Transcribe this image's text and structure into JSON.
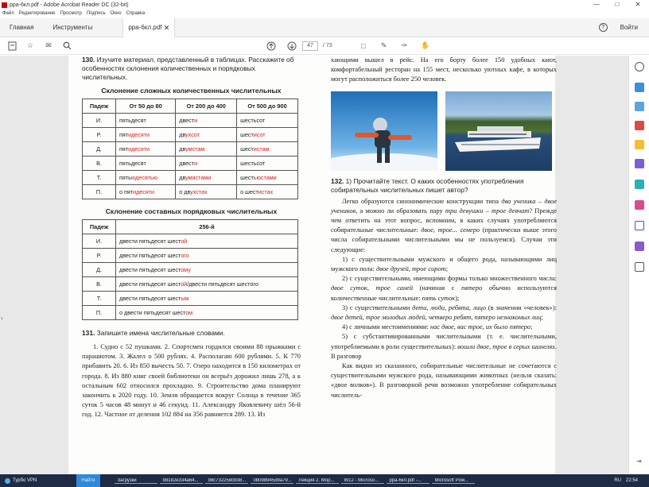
{
  "window": {
    "title": "ppa-6кл.pdf - Adobe Acrobat Reader DC (32-bit)"
  },
  "menu": [
    "Файл",
    "Редактирование",
    "Просмотр",
    "Подпись",
    "Окно",
    "Справка"
  ],
  "tabs": {
    "home": "Главная",
    "tools": "Инструменты",
    "doc": "ppa-6кл.pdf",
    "signin": "Войти"
  },
  "toolbar": {
    "page_current": "47",
    "page_total": "/ 73"
  },
  "left": {
    "task130_num": "130.",
    "task130_text": "Изучите материал, представленный в таблицах. Расскажите об особенностях склонения количественных и порядковых числительных.",
    "table1_title": "Склонение сложных количественных числительных",
    "table1_headers": [
      "Падеж",
      "От 50 до 80",
      "От 200 до 400",
      "От 500 до 900"
    ],
    "table1_rows": [
      {
        "case": "И.",
        "c1a": "пятьдесят",
        "c1b": "",
        "c2a": "двест",
        "c2b": "и",
        "c3a": "шестьсот",
        "c3b": ""
      },
      {
        "case": "Р.",
        "c1a": "пят",
        "c1b": "идесяти",
        "c2a": "дв",
        "c2b": "ухсот",
        "c3a": "шест",
        "c3b": "исот"
      },
      {
        "case": "Д.",
        "c1a": "пят",
        "c1b": "идесяти",
        "c2a": "дв",
        "c2b": "умстам",
        "c3a": "шест",
        "c3b": "истам"
      },
      {
        "case": "В.",
        "c1a": "пятьдесят",
        "c1b": "",
        "c2a": "двест",
        "c2b": "и",
        "c3a": "шестьсот",
        "c3b": ""
      },
      {
        "case": "Т.",
        "c1a": "пять",
        "c1b": "юдесятью",
        "c2a": "дв",
        "c2b": "умястами",
        "c3a": "шест",
        "c3b": "ьюстами"
      },
      {
        "case": "П.",
        "c1a": "о пят",
        "c1b": "идесяти",
        "c2a": "о дв",
        "c2b": "ухстах",
        "c3a": "о шест",
        "c3b": "истах"
      }
    ],
    "table2_title": "Склонение составных порядковых числительных",
    "table2_headers": [
      "Падеж",
      "256-й"
    ],
    "table2_rows": [
      {
        "case": "И.",
        "a": "двести пятьдесят шест",
        "b": "ой",
        "c": ""
      },
      {
        "case": "Р.",
        "a": "двести пятьдесят шест",
        "b": "ого",
        "c": ""
      },
      {
        "case": "Д.",
        "a": "двести пятьдесят шест",
        "b": "ому",
        "c": ""
      },
      {
        "case": "В.",
        "a": "двести пятьдесят шест",
        "b": "ой",
        "c": "/двести пятьдесят шестого"
      },
      {
        "case": "Т.",
        "a": "двести пятьдесят шест",
        "b": "ым",
        "c": ""
      },
      {
        "case": "П.",
        "a": "о двести пятьдесят шест",
        "b": "ом",
        "c": ""
      }
    ],
    "task131_num": "131.",
    "task131_text": "Запишите имена числительные словами.",
    "task131_body": "1. Судно с 52 пушками. 2. Спортсмен гордился своими 88 прыжками с парашютом. 3. Жалел о 500 рублях. 4. Рас­полагаю 600 рублями. 5. К 770 прибавить 20. 6. Из 850 вы­честь 50. 7. Озеро находится в 150 километрах от города. 8. Из 880 книг своей библиотеки он всерьёз дорожил лишь 278, а к остальным 602 относился прохладно. 9. Строитель­ство дома планируют закончить к 2020 году. 10. Земля обра­щается вокруг Солнца в течение 365 суток 5 часов 48 минут и 46 секунд. 11. Александру Яковлевичу шёл 56-й год. 12. Частное от деления 102 884 на 356 равняется 289. 13. Из"
  },
  "right": {
    "top_text": "хающими вышел в рейс. На его борту более 150 удобных ка­ют, комфортабельный ресторан на 155 мест, несколько уют­ных кафе, в которых могут расположиться более 250 человек.",
    "task132_num": "132.",
    "task132_text": "1) Прочитайте текст. О каких особенностях употребления собирательных числительных пишет автор?",
    "p1_a": "Легко образуются синонимические конструкции типа ",
    "p1_i1": "два ученика – двое учеников",
    "p1_b": ", а можно ли образовать пару ",
    "p1_i2": "три девушки – трое девчат",
    "p1_c": "? Прежде чем ответить на этот вопрос, вспомним, в каких случаях употребляются собира­тельные числительные: ",
    "p1_i3": "двое, трое... семеро",
    "p1_d": " (практически выше этого числа собирательными числительными мы не пользуемся). Случаи эти следующие:",
    "l1_a": "1) с существительными мужского и общего рода, назы­вающими лиц мужского пола: ",
    "l1_i": "двое друзей, трое сирот",
    "l1_b": ";",
    "l2_a": "2) с существительными, имеющими формы только мно­жественного числа: ",
    "l2_i": "двое суток, трое саней",
    "l2_b": " (начиная с ",
    "l2_i2": "пяте­ро",
    "l2_c": " обычно используются количественные числительные: ",
    "l2_i3": "пять суток",
    "l2_d": ");",
    "l3_a": "3) с существительными ",
    "l3_i": "дети, люди, ребята, лицо",
    "l3_b": " (в значении «человек»): ",
    "l3_i2": "двое детей, трое молодых людей, четверо ребят, пятеро незнакомых лиц",
    "l3_c": ";",
    "l4_a": "4) с личными местоимениями: ",
    "l4_i": "нас двое, вас трое, их бы­ло пятеро",
    "l4_b": ";",
    "l5_a": "5) с субстантивированными числительными (т. е. числи­тельными, употребляемыми в роли существительных): ",
    "l5_i": "во­шли двое, трое в серых шинелях",
    "l5_b": ". В разговор",
    "p2": "Как видно из сказанного, собирательные числительные не сочетаются с существительными мужского рода, называю­щими животных (нельзя сказать: «двое волков»). В разговор­ной речи возможно употребление собирательных числитель-"
  },
  "taskbar": {
    "vpn": "Турбо VPN",
    "start": "Найти",
    "items": [
      "Загрузки",
      "98182e334a64...",
      "98c73225dcb38...",
      "0b098945d9a79...",
      "Лекция 2. Мор...",
      "W12 - Microso...",
      "ppa-6кл.pdf -...",
      "Microsoft Pow..."
    ],
    "lang": "RU",
    "time": "22:54"
  }
}
